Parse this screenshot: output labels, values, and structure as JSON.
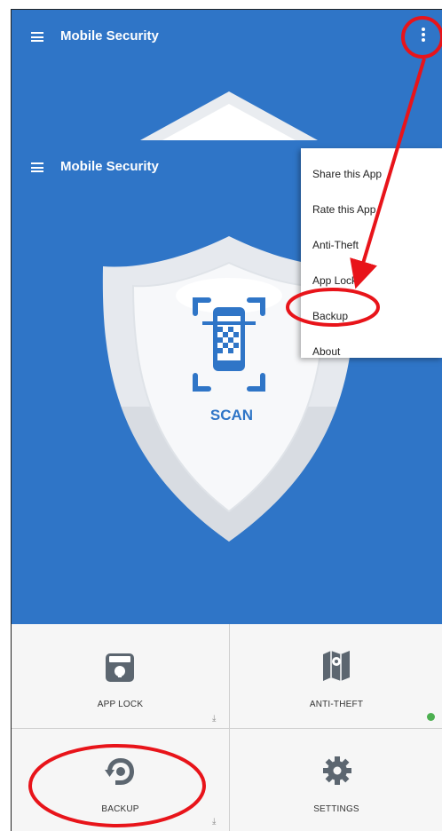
{
  "app_title": "Mobile Security",
  "menu": {
    "items": [
      "Share this App",
      "Rate this App",
      "Anti-Theft",
      "App Lock",
      "Backup",
      "About"
    ]
  },
  "scan": {
    "label": "SCAN"
  },
  "tiles": {
    "app_lock": {
      "label": "APP LOCK"
    },
    "anti_theft": {
      "label": "ANTI-THEFT"
    },
    "backup": {
      "label": "BACKUP"
    },
    "settings": {
      "label": "SETTINGS"
    }
  },
  "colors": {
    "primary": "#2f75c7",
    "highlight": "#e8141a",
    "status_ok": "#4caf50"
  },
  "icons": [
    "menu-icon",
    "more-vert-icon",
    "scan-phone-icon",
    "app-lock-icon",
    "anti-theft-map-icon",
    "backup-icon",
    "settings-gear-icon",
    "download-icon",
    "status-ok-icon"
  ]
}
